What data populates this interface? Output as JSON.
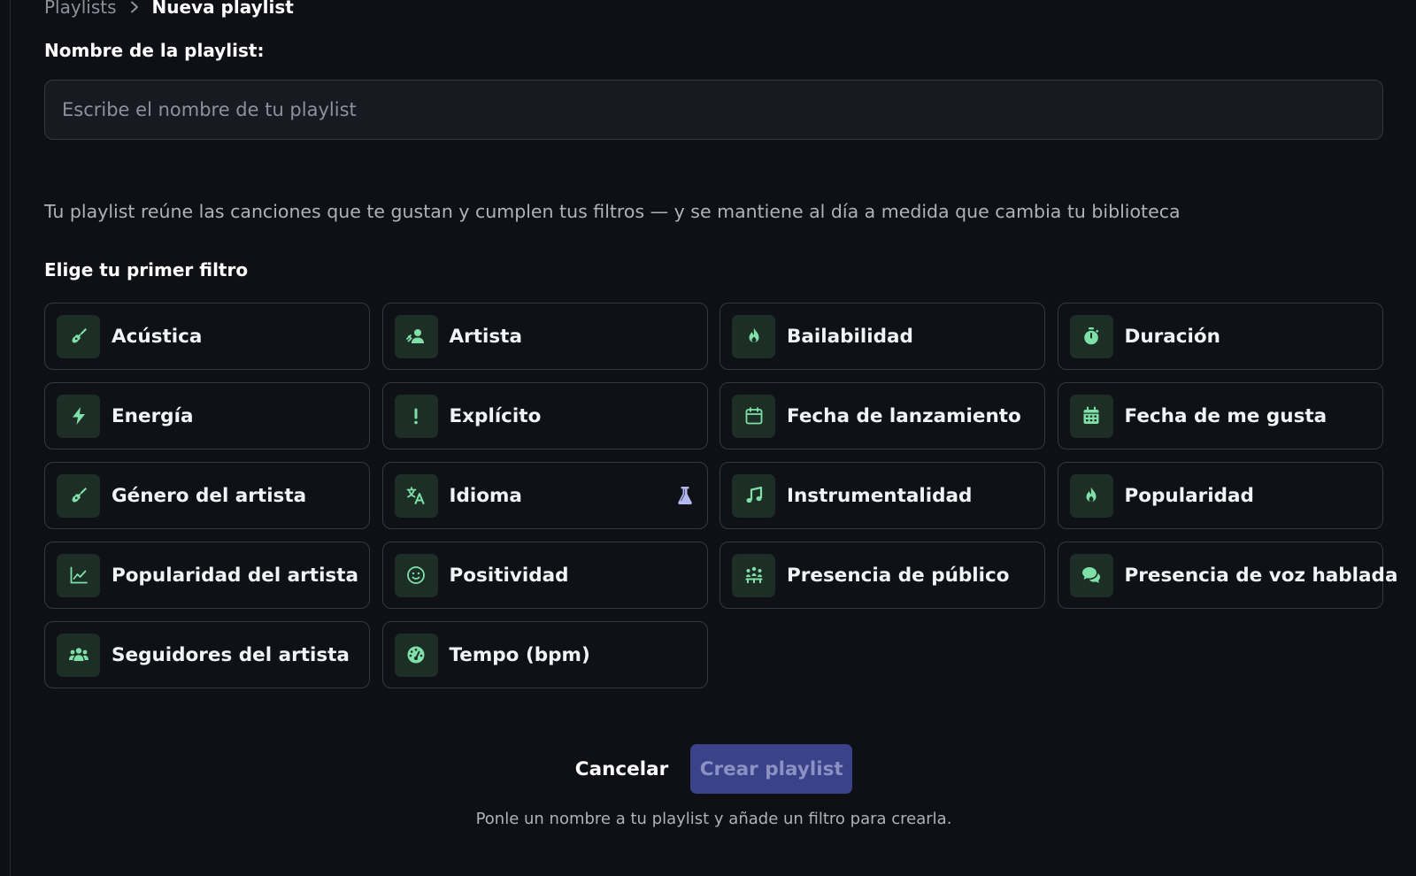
{
  "breadcrumb": {
    "parent": "Playlists",
    "current": "Nueva playlist"
  },
  "form": {
    "name_label": "Nombre de la playlist:",
    "name_placeholder": "Escribe el nombre de tu playlist",
    "name_value": ""
  },
  "description": "Tu playlist reúne las canciones que te gustan y cumplen tus filtros — y se mantiene al día a medida que cambia tu biblioteca",
  "filters": {
    "heading": "Elige tu primer filtro",
    "items": [
      {
        "label": "Acústica",
        "icon": "guitar-icon"
      },
      {
        "label": "Artista",
        "icon": "artist-icon"
      },
      {
        "label": "Bailabilidad",
        "icon": "fire-icon"
      },
      {
        "label": "Duración",
        "icon": "stopwatch-icon"
      },
      {
        "label": "Energía",
        "icon": "bolt-icon"
      },
      {
        "label": "Explícito",
        "icon": "exclamation-icon"
      },
      {
        "label": "Fecha de lanzamiento",
        "icon": "calendar-outline-icon"
      },
      {
        "label": "Fecha de me gusta",
        "icon": "calendar-days-icon"
      },
      {
        "label": "Género del artista",
        "icon": "guitar-icon"
      },
      {
        "label": "Idioma",
        "icon": "translate-icon",
        "badge_icon": "flask-icon"
      },
      {
        "label": "Instrumentalidad",
        "icon": "music-note-icon"
      },
      {
        "label": "Popularidad",
        "icon": "fire-icon"
      },
      {
        "label": "Popularidad del artista",
        "icon": "chart-line-icon"
      },
      {
        "label": "Positividad",
        "icon": "smile-icon"
      },
      {
        "label": "Presencia de público",
        "icon": "audience-icon"
      },
      {
        "label": "Presencia de voz hablada",
        "icon": "speech-bubbles-icon"
      },
      {
        "label": "Seguidores del artista",
        "icon": "users-icon"
      },
      {
        "label": "Tempo (bpm)",
        "icon": "gauge-icon"
      }
    ]
  },
  "actions": {
    "cancel_label": "Cancelar",
    "create_label": "Crear playlist"
  },
  "hint": "Ponle un nombre a tu playlist y añade un filtro para crearla.",
  "colors": {
    "background": "#0e1015",
    "icon_green": "#7ee0a6",
    "icon_tile": "#1d2e27",
    "card_border": "#343842",
    "primary_button": "#3a428a",
    "beta_icon": "#b4b8f0"
  }
}
